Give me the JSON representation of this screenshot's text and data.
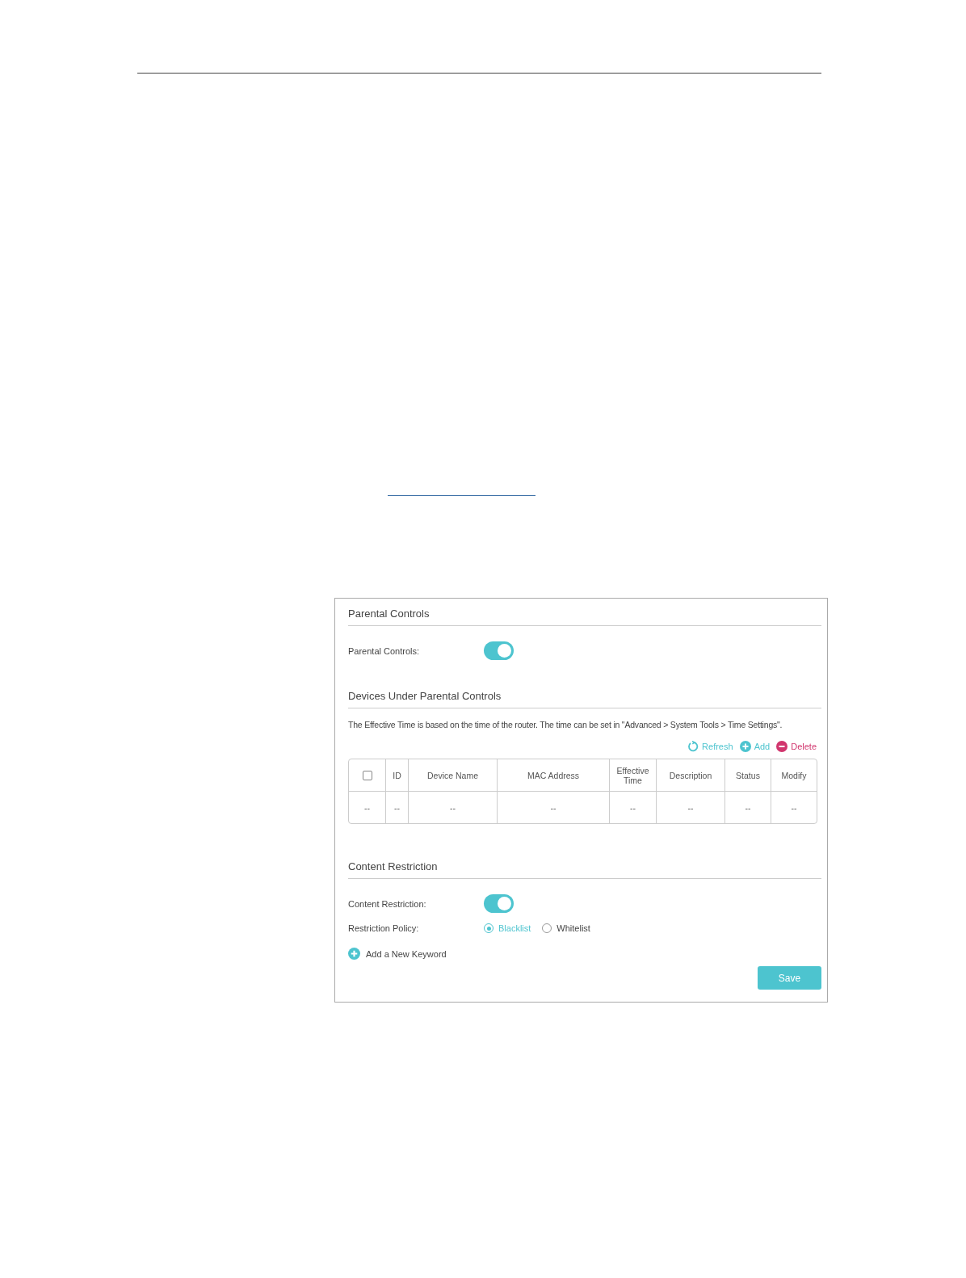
{
  "panel": {
    "parental_section": {
      "title": "Parental Controls",
      "toggle": {
        "label": "Parental Controls:",
        "on": true
      }
    },
    "devices_section": {
      "title": "Devices Under Parental Controls",
      "note": "The Effective Time is based on the time of the router. The time can be set in \"Advanced > System Tools > Time Settings\".",
      "actions": [
        {
          "kind": "refresh",
          "label": "Refresh"
        },
        {
          "kind": "add",
          "label": "Add"
        },
        {
          "kind": "delete",
          "label": "Delete"
        }
      ],
      "table": {
        "columns": [
          {
            "kind": "checkbox",
            "checked": false
          },
          {
            "kind": "text",
            "label": "ID"
          },
          {
            "kind": "text",
            "label": "Device Name"
          },
          {
            "kind": "text",
            "label": "MAC Address"
          },
          {
            "kind": "text",
            "label": "Effective Time"
          },
          {
            "kind": "text",
            "label": "Description"
          },
          {
            "kind": "text",
            "label": "Status"
          },
          {
            "kind": "text",
            "label": "Modify"
          }
        ],
        "rows": [
          [
            "--",
            "--",
            "--",
            "--",
            "--",
            "--",
            "--",
            "--"
          ]
        ]
      }
    },
    "content_section": {
      "title": "Content Restriction",
      "toggle": {
        "label": "Content Restriction:",
        "on": true
      },
      "policy": {
        "label": "Restriction Policy:",
        "options": [
          {
            "label": "Blacklist",
            "selected": true
          },
          {
            "label": "Whitelist",
            "selected": false
          }
        ]
      },
      "add_keyword": "Add a New Keyword"
    },
    "save_button": "Save"
  }
}
